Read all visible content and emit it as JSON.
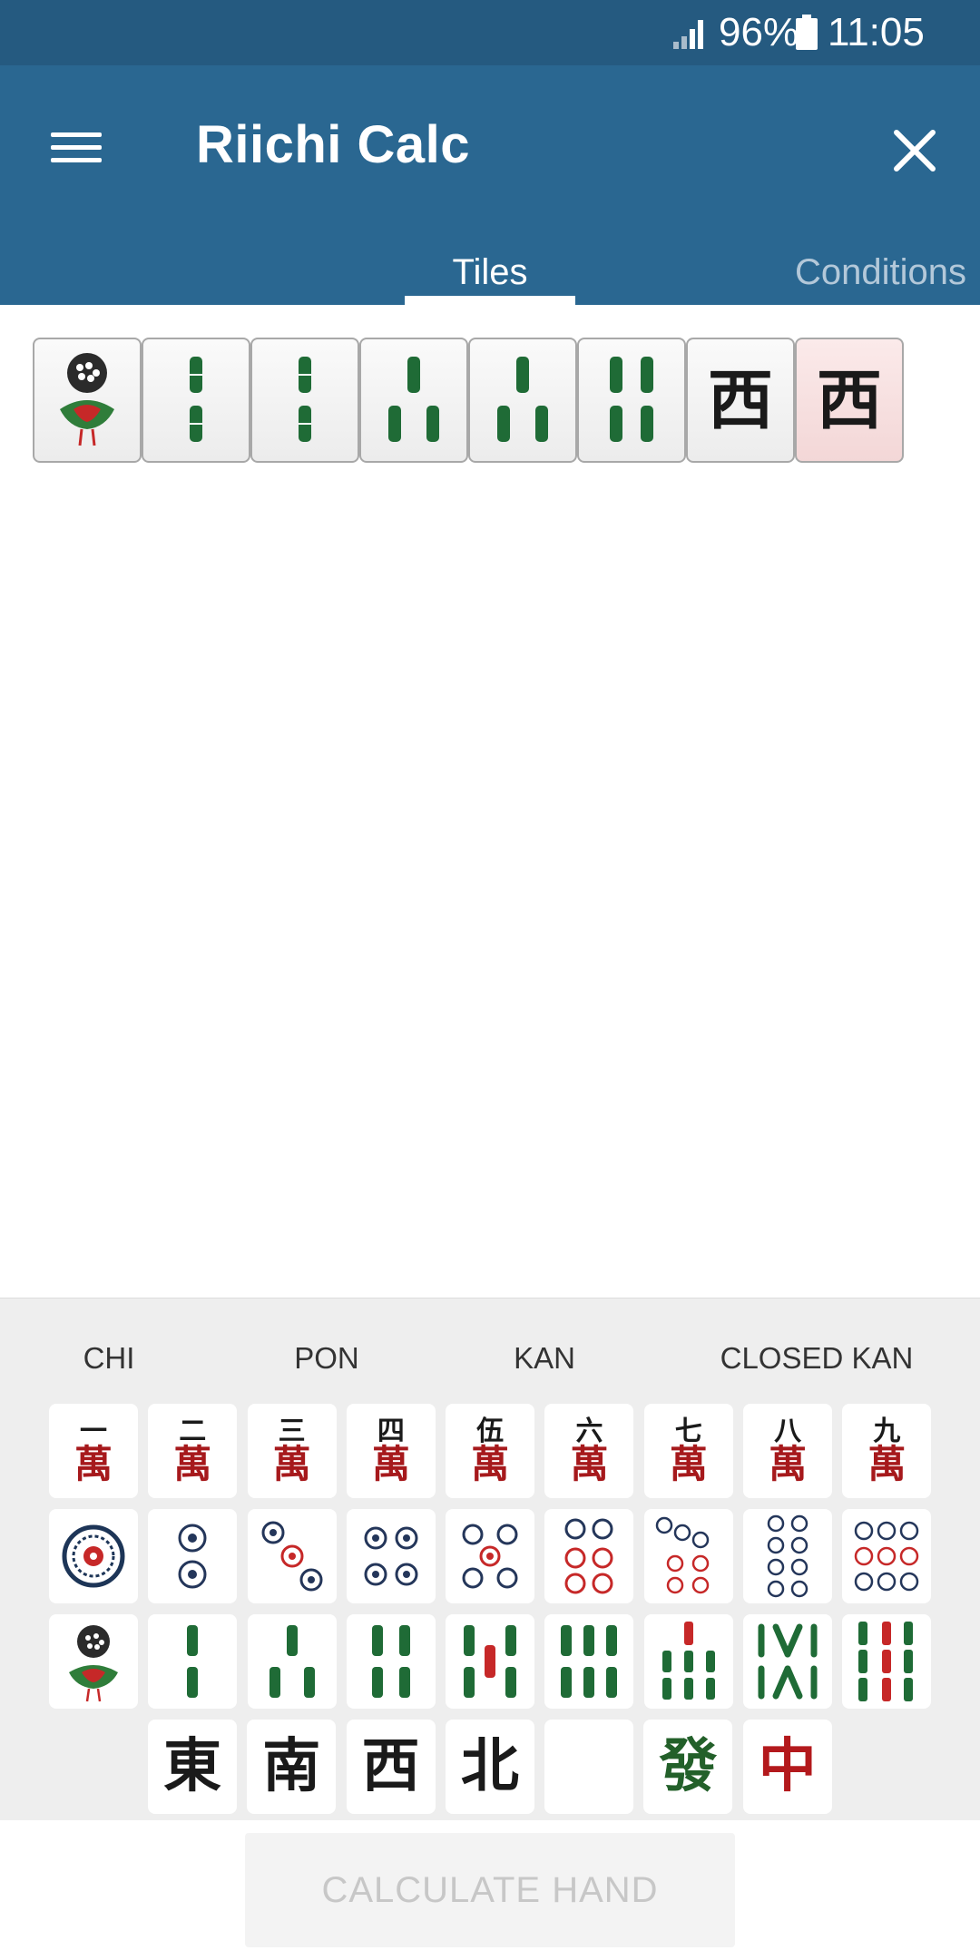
{
  "status_bar": {
    "battery": "96%",
    "time": "11:05",
    "signal_icon": "signal-icon",
    "battery_icon": "battery-icon"
  },
  "app_bar": {
    "title": "Riichi Calc",
    "menu_icon": "menu-icon",
    "close_icon": "close-icon",
    "bg_color": "#2a6791"
  },
  "tabs": [
    {
      "label": "Tiles",
      "active": true
    },
    {
      "label": "Conditions",
      "active": false
    }
  ],
  "hand": [
    {
      "tile": "1 sou (bird)",
      "selected": false
    },
    {
      "tile": "2 sou",
      "selected": false
    },
    {
      "tile": "2 sou",
      "selected": false
    },
    {
      "tile": "3 sou",
      "selected": false
    },
    {
      "tile": "3 sou",
      "selected": false
    },
    {
      "tile": "4 sou",
      "selected": false
    },
    {
      "tile": "West",
      "selected": false
    },
    {
      "tile": "West",
      "selected": true
    }
  ],
  "meld_buttons": {
    "chi": "CHI",
    "pon": "PON",
    "kan": "KAN",
    "closed_kan": "CLOSED KAN"
  },
  "picker": {
    "man": [
      {
        "top": "一",
        "bottom": "萬"
      },
      {
        "top": "二",
        "bottom": "萬"
      },
      {
        "top": "三",
        "bottom": "萬"
      },
      {
        "top": "四",
        "bottom": "萬"
      },
      {
        "top": "伍",
        "bottom": "萬"
      },
      {
        "top": "六",
        "bottom": "萬"
      },
      {
        "top": "七",
        "bottom": "萬"
      },
      {
        "top": "八",
        "bottom": "萬"
      },
      {
        "top": "九",
        "bottom": "萬"
      }
    ],
    "pin": [
      "1 pin",
      "2 pin",
      "3 pin",
      "4 pin",
      "5 pin",
      "6 pin",
      "7 pin",
      "8 pin",
      "9 pin"
    ],
    "sou": [
      "1 sou",
      "2 sou",
      "3 sou",
      "4 sou",
      "5 sou",
      "6 sou",
      "7 sou",
      "8 sou",
      "9 sou"
    ],
    "honors": [
      {
        "char": "東",
        "color": "#1a1a1a"
      },
      {
        "char": "南",
        "color": "#1a1a1a"
      },
      {
        "char": "西",
        "color": "#1a1a1a"
      },
      {
        "char": "北",
        "color": "#1a1a1a"
      },
      {
        "char": "",
        "color": "#1a1a1a"
      },
      {
        "char": "發",
        "color": "#23602a"
      },
      {
        "char": "中",
        "color": "#b3191c"
      }
    ]
  },
  "calculate_button": "CALCULATE HAND"
}
